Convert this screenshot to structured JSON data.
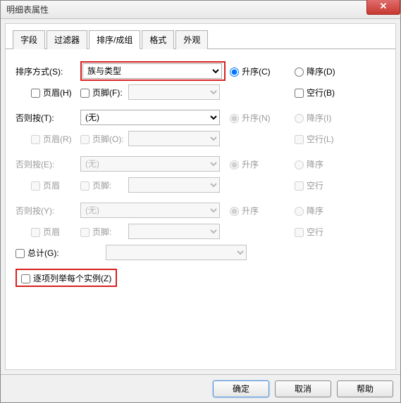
{
  "window_title": "明细表属性",
  "tabs": [
    "字段",
    "过滤器",
    "排序/成组",
    "格式",
    "外观"
  ],
  "active_tab": 2,
  "labels": {
    "sort_by": "排序方式(S):",
    "then_by_t": "否则按(T):",
    "then_by_e": "否则按(E):",
    "then_by_y": "否则按(Y):",
    "header_h": "页眉(H)",
    "header_r": "页眉(R)",
    "header_g1": "页眉",
    "header_g2": "页眉",
    "footer_f": "页脚(F):",
    "footer_o": "页脚(O):",
    "footer_g1": "页脚:",
    "footer_g2": "页脚:",
    "asc_c": "升序(C)",
    "asc_n": "升序(N)",
    "asc_g1": "升序",
    "asc_g2": "升序",
    "desc_d": "降序(D)",
    "desc_i": "降序(I)",
    "desc_g1": "降序",
    "desc_g2": "降序",
    "blank_b": "空行(B)",
    "blank_l": "空行(L)",
    "blank_g1": "空行",
    "blank_g2": "空行",
    "totals": "总计(G):",
    "list_each": "逐项列举每个实例(Z)"
  },
  "values": {
    "sort_by": "族与类型",
    "then_by_t": "(无)",
    "then_by_e": "(无)",
    "then_by_y": "(无)"
  },
  "buttons": {
    "ok": "确定",
    "cancel": "取消",
    "help": "帮助"
  }
}
